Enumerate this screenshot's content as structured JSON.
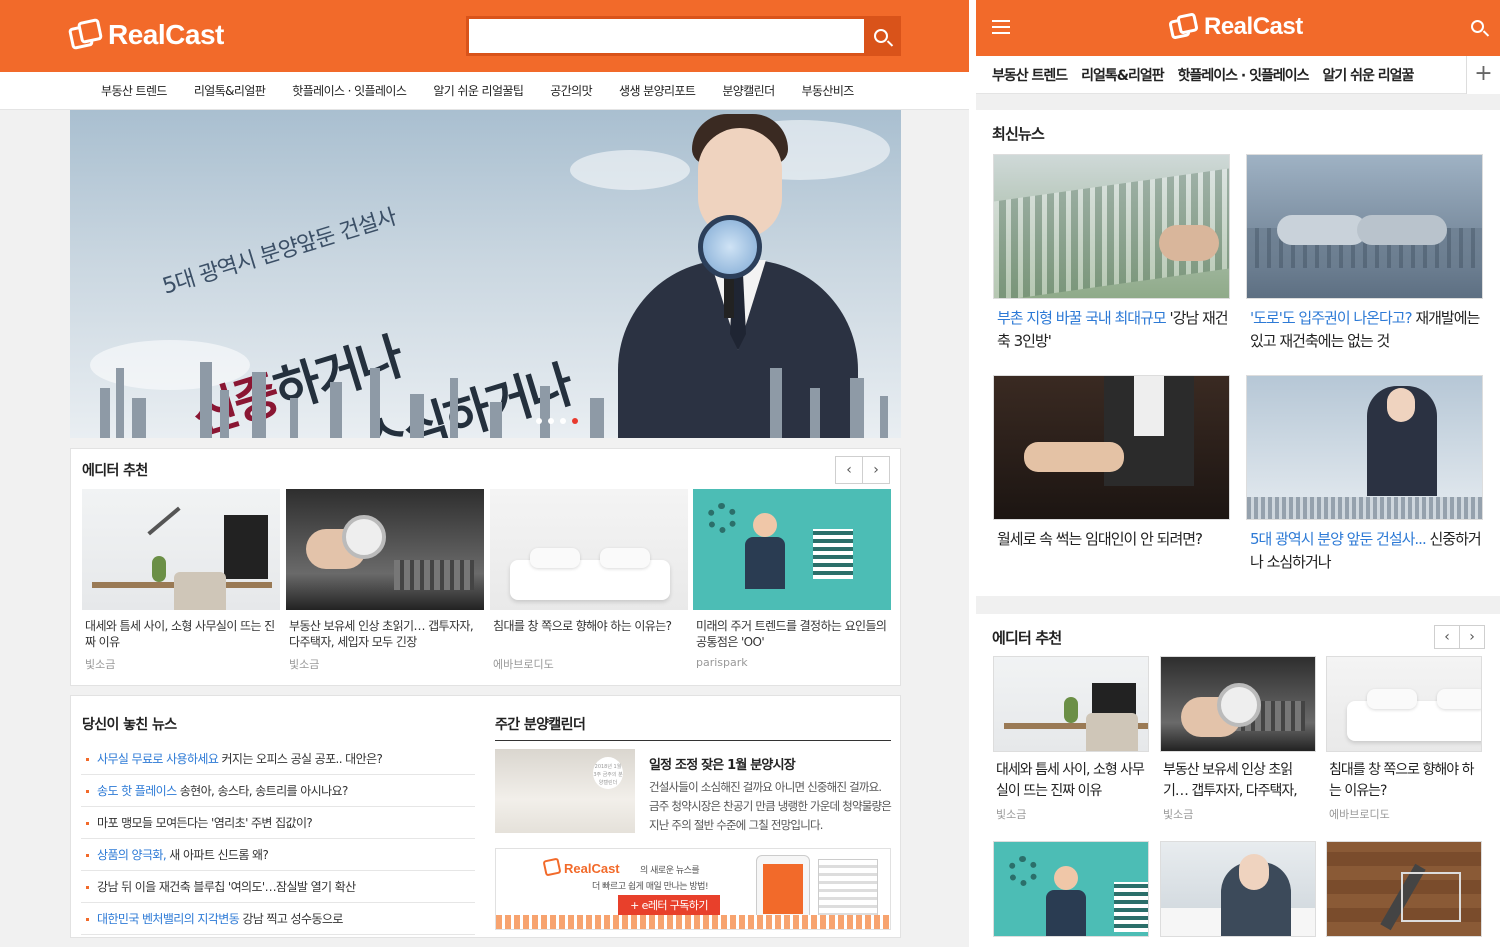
{
  "brand": {
    "name": "RealCast",
    "accent": "#f26a2a"
  },
  "desktop": {
    "nav": [
      "부동산 트렌드",
      "리얼톡&리얼판",
      "핫플레이스 · 잇플레이스",
      "알기 쉬운 리얼꿀팁",
      "공간의맛",
      "생생 분양리포트",
      "분양캘린더",
      "부동산비즈"
    ],
    "hero": {
      "subtitle": "5대 광역시 분양앞둔 건설사",
      "line1_red": "신중",
      "line1_dark": "하거나",
      "line2": "소심하거나"
    },
    "editor": {
      "title": "에디터 추천",
      "prev": "‹",
      "next": "›",
      "cards": [
        {
          "text": "대세와 틈세 사이, 소형 사무실이 뜨는 진짜 이유",
          "by": "빛소금"
        },
        {
          "text": "부동산 보유세 인상 초읽기… 갭투자자, 다주택자, 세입자 모두 긴장",
          "by": "빛소금"
        },
        {
          "text": "침대를 창 쪽으로 향해야 하는 이유는?",
          "by": "에바브로디도"
        },
        {
          "text": "미래의 주거 트렌드를 결정하는 요인들의 공통점은 'OO'",
          "by": "parispark"
        }
      ]
    },
    "missed": {
      "title": "당신이 놓친 뉴스",
      "items": [
        {
          "hl": "사무실 무료로 사용하세요",
          "rest": " 커지는 오피스 공실 공포.. 대안은?"
        },
        {
          "hl": "송도 핫 플레이스",
          "rest": " 송현아, 송스타, 송트리를 아시나요?"
        },
        {
          "hl": "",
          "rest": "마포 맹모들 모여든다는 '염리초' 주변 집값이?"
        },
        {
          "hl": "상품의 양극화,",
          "rest": " 새 아파트 신드롬 왜?"
        },
        {
          "hl": "",
          "rest": "강남 뒤 이을 재건축 블루칩 '여의도'…잠실발 열기 확산"
        },
        {
          "hl": "대한민국 벤처밸리의 지각변동",
          "rest": " 강남 찍고 성수동으로"
        }
      ]
    },
    "calendar": {
      "title": "주간 분양캘린더",
      "article_title": "일정 조정 잦은 1월 분양시장",
      "article_desc": "건설사들이 소심해진 걸까요 아니면 신중해진 걸까요. 금주 청약시장은 찬공기 만큼 냉랭한 가운데 청약물량은 지난 주의 절반 수준에 그칠 전망입니다.",
      "thumb_badge": "2018년 1월 3주 금주의 분양캘린더",
      "banner_brand": "RealCast",
      "banner_line1": "의 새로운 뉴스를",
      "banner_line2": "더 빠르고 쉽게 매일 만나는 방법!",
      "banner_button": "+ e레터 구독하기"
    }
  },
  "mobile": {
    "nav": [
      "부동산 트렌드",
      "리얼톡&리얼판",
      "핫플레이스 · 잇플레이스",
      "알기 쉬운 리얼꿀"
    ],
    "more": "+",
    "latest": {
      "title": "최신뉴스",
      "cards": [
        {
          "hl": "부촌 지형 바꿀 국내 최대규모",
          "rest": " '강남 재건축 3인방'"
        },
        {
          "hl": "'도로'도 입주권이 나온다고?",
          "rest": " 재개발에는 있고 재건축에는 없는 것"
        },
        {
          "hl": "",
          "rest": "월세로 속 썩는 임대인이 안 되려면?"
        },
        {
          "hl": "5대 광역시 분양 앞둔 건설사...",
          "rest": " 신중하거나 소심하거나"
        }
      ]
    },
    "editor": {
      "title": "에디터 추천",
      "prev": "‹",
      "next": "›",
      "cards": [
        {
          "text": "대세와 틈세 사이, 소형 사무실이 뜨는 진짜 이유",
          "by": "빛소금"
        },
        {
          "text": "부동산 보유세 인상 초읽기… 갭투자자, 다주택자,",
          "by": "빛소금"
        },
        {
          "text": "침대를 창 쪽으로 향해야 하는 이유는?",
          "by": "에바브로디도"
        }
      ]
    }
  }
}
